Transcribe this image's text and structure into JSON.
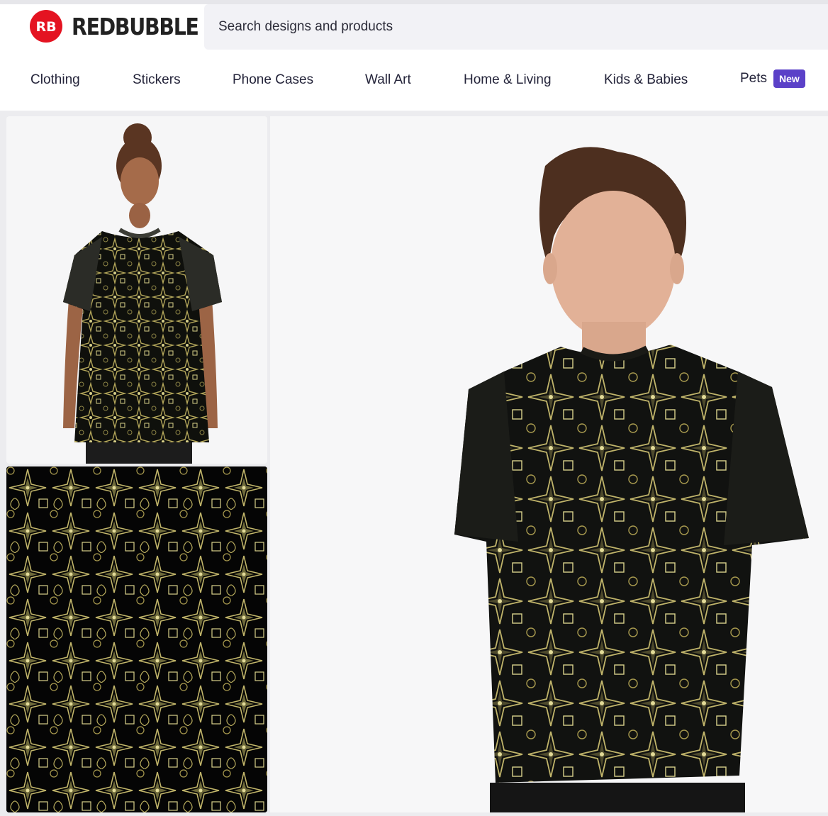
{
  "brand": {
    "name": "REDBUBBLE",
    "badge_text": "RB",
    "color": "#e41321"
  },
  "search": {
    "placeholder": "Search designs and products"
  },
  "nav": {
    "items": [
      {
        "label": "Clothing"
      },
      {
        "label": "Stickers"
      },
      {
        "label": "Phone Cases"
      },
      {
        "label": "Wall Art"
      },
      {
        "label": "Home & Living"
      },
      {
        "label": "Kids & Babies"
      },
      {
        "label": "Pets",
        "badge": "New"
      }
    ],
    "badge_color": "#5b41c8"
  },
  "gallery": {
    "thumbnails": [
      {
        "view": "woman wearing graphic t-shirt"
      },
      {
        "view": "print design pattern"
      }
    ],
    "main_image": "man wearing graphic t-shirt",
    "pattern_colors": [
      "#0b0b0b",
      "#a89a4e",
      "#d8d08a",
      "#6e6a3a"
    ]
  }
}
